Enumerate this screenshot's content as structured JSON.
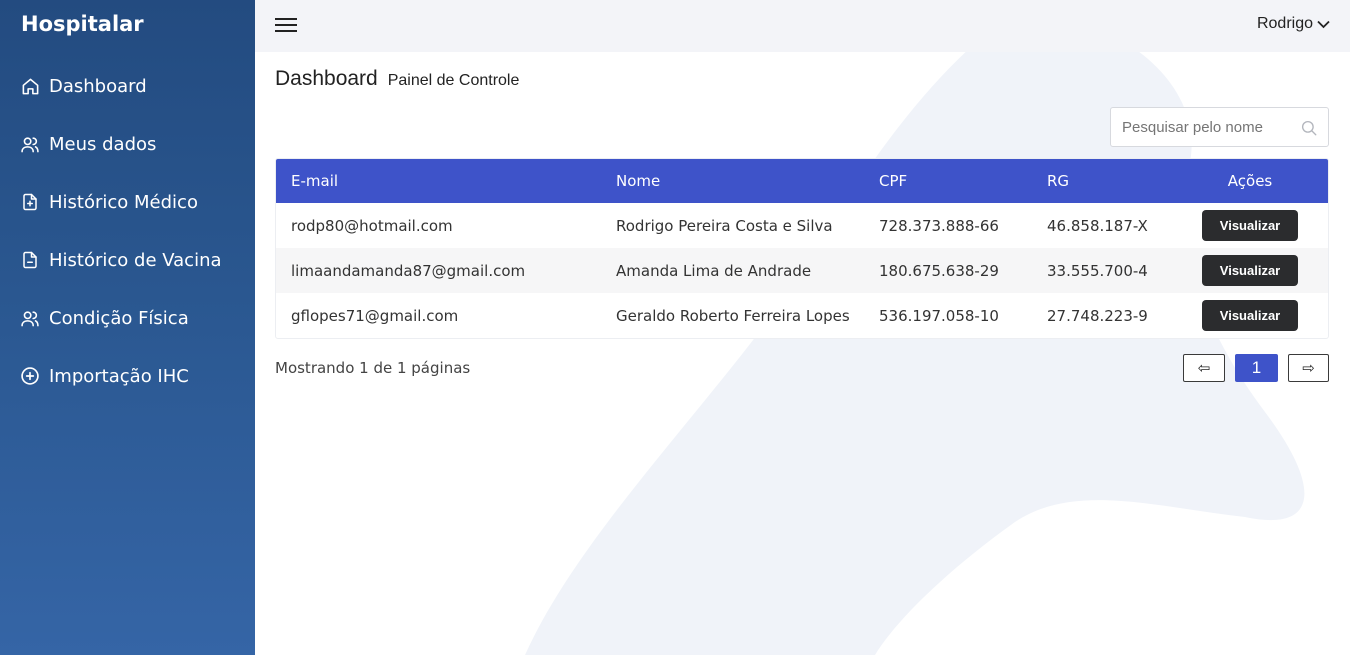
{
  "sidebar": {
    "brand": "Hospitalar",
    "items": [
      {
        "label": "Dashboard",
        "icon": "home-icon"
      },
      {
        "label": "Meus dados",
        "icon": "users-icon"
      },
      {
        "label": "Histórico Médico",
        "icon": "file-plus-icon"
      },
      {
        "label": "Histórico de Vacina",
        "icon": "file-icon"
      },
      {
        "label": "Condição Física",
        "icon": "users-icon"
      },
      {
        "label": "Importação IHC",
        "icon": "plus-circle-icon"
      }
    ]
  },
  "topbar": {
    "user": "Rodrigo"
  },
  "header": {
    "title": "Dashboard",
    "subtitle": "Painel de Controle"
  },
  "search": {
    "placeholder": "Pesquisar pelo nome"
  },
  "table": {
    "columns": [
      "E-mail",
      "Nome",
      "CPF",
      "RG",
      "Ações"
    ],
    "rows": [
      {
        "email": "rodp80@hotmail.com",
        "nome": "Rodrigo Pereira Costa e Silva",
        "cpf": "728.373.888-66",
        "rg": "46.858.187-X",
        "action": "Visualizar"
      },
      {
        "email": "limaandamanda87@gmail.com",
        "nome": "Amanda Lima de Andrade",
        "cpf": "180.675.638-29",
        "rg": "33.555.700-4",
        "action": "Visualizar"
      },
      {
        "email": "gflopes71@gmail.com",
        "nome": "Geraldo Roberto Ferreira Lopes",
        "cpf": "536.197.058-10",
        "rg": "27.748.223-9",
        "action": "Visualizar"
      }
    ]
  },
  "pagination": {
    "info": "Mostrando 1 de 1 páginas",
    "prev": "⇦",
    "current": "1",
    "next": "⇨"
  },
  "colors": {
    "primary": "#3e53c9",
    "sidebar_top": "#234b80",
    "sidebar_bottom": "#3565a6",
    "button_dark": "#2b2c2e"
  }
}
